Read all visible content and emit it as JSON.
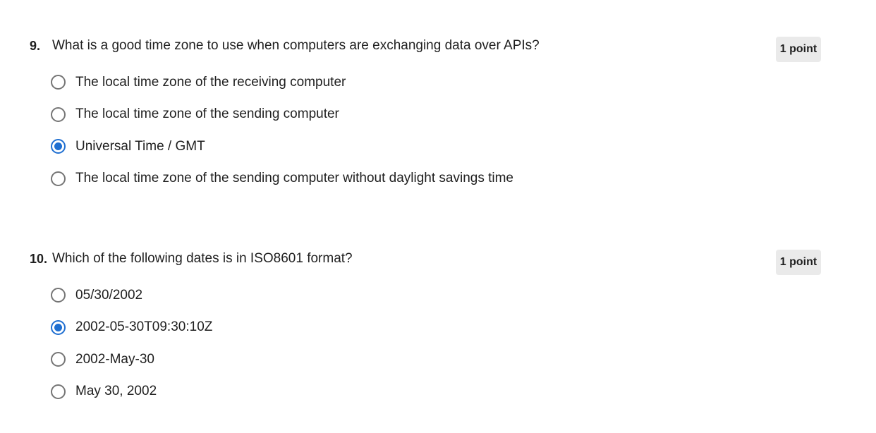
{
  "questions": [
    {
      "number": "9.",
      "text": "What is a good time zone to use when computers are exchanging data over APIs?",
      "points": "1 point",
      "options": [
        {
          "label": "The local time zone of the receiving computer",
          "selected": false
        },
        {
          "label": "The local time zone of the sending computer",
          "selected": false
        },
        {
          "label": "Universal Time / GMT",
          "selected": true
        },
        {
          "label": "The local time zone of the sending computer without daylight savings time",
          "selected": false
        }
      ]
    },
    {
      "number": "10.",
      "text": "Which of the following dates is in ISO8601 format?",
      "points": "1 point",
      "options": [
        {
          "label": "05/30/2002",
          "selected": false
        },
        {
          "label": "2002-05-30T09:30:10Z",
          "selected": true
        },
        {
          "label": "2002-May-30",
          "selected": false
        },
        {
          "label": "May 30, 2002",
          "selected": false
        }
      ]
    }
  ],
  "colors": {
    "accent": "#1f6fd1",
    "radio_border": "#757575",
    "badge_bg": "#eaeaea",
    "text": "#1f1f1f"
  }
}
